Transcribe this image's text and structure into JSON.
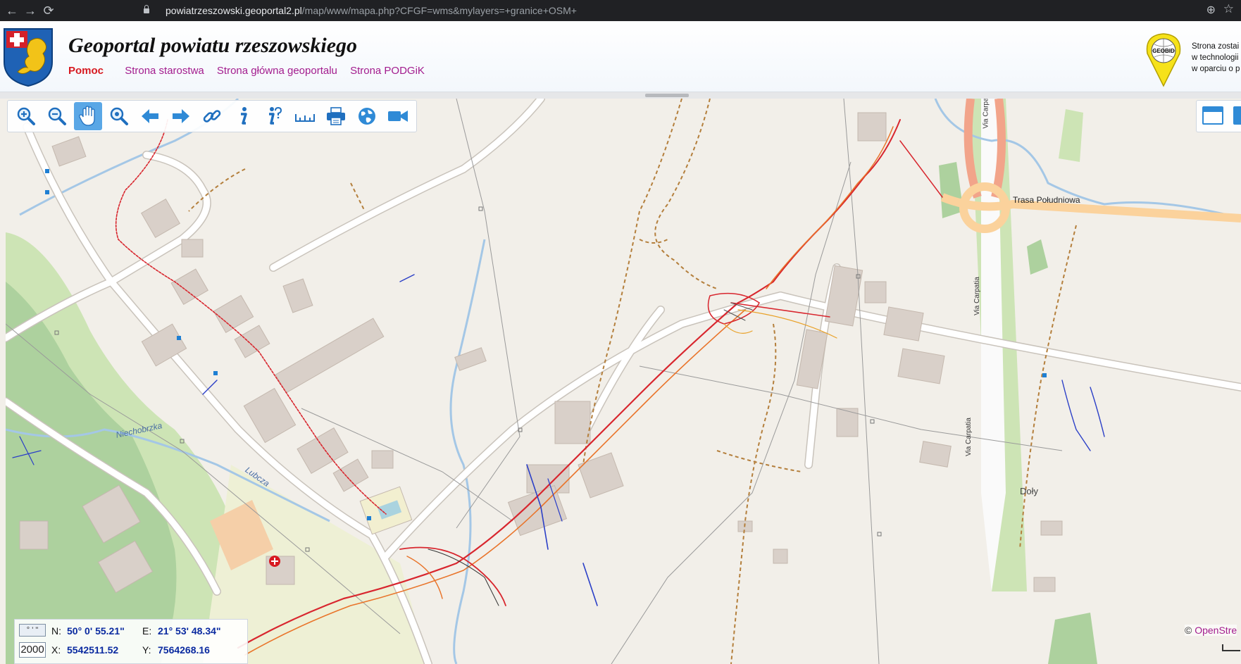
{
  "browser": {
    "url_host": "powiatrzeszowski.geoportal2.pl",
    "url_path": "/map/www/mapa.php?CFGF=wms&mylayers=+granice+OSM+"
  },
  "header": {
    "title": "Geoportal powiatu rzeszowskiego",
    "links": {
      "help": "Pomoc",
      "starostwo": "Strona starostwa",
      "main": "Strona główna geoportalu",
      "podgik": "Strona PODGiK"
    },
    "geobid_logo_text": "GEOBID",
    "geobid_note": [
      "Strona zostai",
      "w technologii",
      "w oparciu o p"
    ]
  },
  "toolbar": {
    "tools": [
      "zoom-in",
      "zoom-out",
      "pan",
      "zoom-extent",
      "previous-view",
      "next-view",
      "link",
      "info",
      "info-query",
      "measure",
      "print",
      "map-services",
      "video"
    ],
    "active_tool": "pan"
  },
  "map": {
    "labels": {
      "niechobrzka": "Niechobrzka",
      "lubcza": "Lubcza",
      "trasa": "Trasa Południowa",
      "doly": "Doły",
      "via_carpatia_1": "Via Carpatia",
      "via_carpatia_2": "Via Carpatia",
      "via_carpatia_3": "Via Carpa"
    },
    "attribution_prefix": "©",
    "attribution_link": "OpenStre"
  },
  "coords": {
    "format_button": "° ' \"",
    "scale": "2000",
    "n_label": "N:",
    "n_value": "50° 0' 55.21\"",
    "e_label": "E:",
    "e_value": "21° 53' 48.34\"",
    "x_label": "X:",
    "x_value": "5542511.52",
    "y_label": "Y:",
    "y_value": "7564268.16"
  },
  "colors": {
    "accent": "#2f8ad6",
    "help_link": "#d71920",
    "link": "#a31c8e",
    "coord_value": "#0a2aa0",
    "map_bg": "#f2efe9"
  }
}
